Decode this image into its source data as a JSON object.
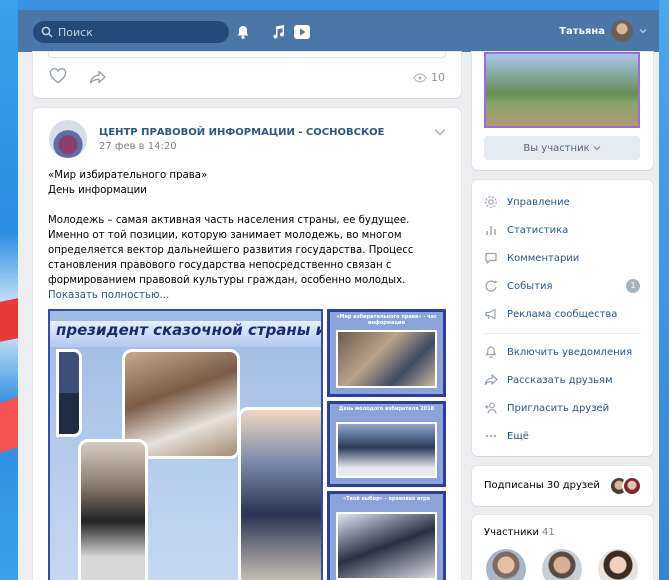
{
  "header": {
    "search_placeholder": "Поиск",
    "user_name": "Татьяна"
  },
  "prev_post": {
    "views": "10"
  },
  "post": {
    "author": "ЦЕНТР ПРАВОВОЙ ИНФОРМАЦИИ - СОСНОВСКОЕ",
    "date": "27 фев в 14:20",
    "line1": "«Мир избирательного права»",
    "line2": "День информации",
    "body": "Молодежь – самая активная часть населения страны, ее будущее. Именно от той позиции, которую занимает молодежь, во многом определяется вектор дальнейшего развития государства. Процесс становления правового государства непосредственно связан с формированием правовой культуры граждан, особенно молодых.",
    "show_more": "Показать полностью...",
    "media_title": "президент  сказочной страны избра",
    "side_captions": [
      "«Мир избирательного права» - час информации",
      "День молодого избирателя 2018",
      "«Твой выбор» - правовая игра"
    ]
  },
  "sidebar": {
    "member_button": "Вы участник",
    "menu": [
      {
        "label": "Управление",
        "icon": "gear-icon"
      },
      {
        "label": "Статистика",
        "icon": "stats-icon"
      },
      {
        "label": "Комментарии",
        "icon": "comment-icon"
      },
      {
        "label": "События",
        "icon": "events-icon",
        "badge": "1"
      },
      {
        "label": "Реклама сообщества",
        "icon": "megaphone-icon"
      },
      {
        "label": "Включить уведомления",
        "icon": "bell-icon"
      },
      {
        "label": "Рассказать друзьям",
        "icon": "share-icon"
      },
      {
        "label": "Пригласить друзей",
        "icon": "add-user-icon"
      },
      {
        "label": "Ещё",
        "icon": "more-icon"
      }
    ],
    "friends_label": "Подписаны 30 друзей",
    "members_title": "Участники",
    "members_count": "41"
  },
  "colors": {
    "header_bg": "#4a76a8",
    "link": "#2a5885",
    "page_bg": "#edeef0"
  }
}
